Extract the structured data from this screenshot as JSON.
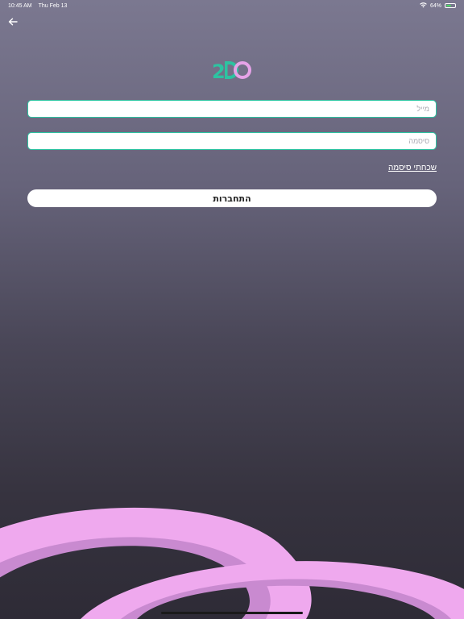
{
  "status_bar": {
    "time": "10:45 AM",
    "date": "Thu Feb 13",
    "battery": "64%",
    "battery_level": 0.64
  },
  "logo": {
    "text": "2DO",
    "colors": {
      "green": "#2dc3a1",
      "pink": "#e6a3e8"
    }
  },
  "form": {
    "email_placeholder": "מייל",
    "email_value": "",
    "password_placeholder": "סיסמה",
    "password_value": "",
    "forgot_password_label": "שכחתי סיסמה",
    "login_button_label": "התחברות"
  },
  "icons": {
    "back": "arrow-left-icon",
    "wifi": "wifi-icon",
    "battery": "battery-icon"
  },
  "colors": {
    "accent": "#2dc3a1",
    "decor_pink": "#efa9ee",
    "decor_pink_dark": "#c98ad0"
  }
}
